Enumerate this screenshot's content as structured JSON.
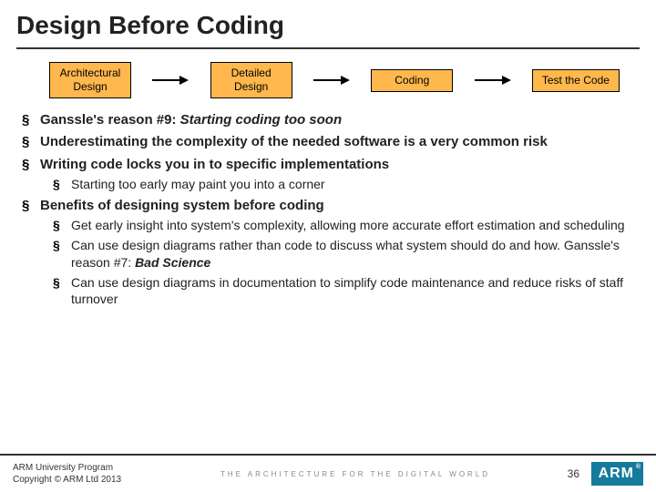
{
  "title": "Design Before Coding",
  "flow": {
    "boxes": [
      "Architectural\nDesign",
      "Detailed\nDesign",
      "Coding",
      "Test the Code"
    ]
  },
  "bullets": {
    "b1_pre": "Ganssle's reason #9: ",
    "b1_ital": "Starting coding too soon",
    "b2": "Underestimating the complexity of the needed software is a very common risk",
    "b3": "Writing code locks you in to specific implementations",
    "b3_sub1": "Starting too early may paint you into a corner",
    "b4": "Benefits of designing system before coding",
    "b4_sub1": "Get early insight into system's complexity, allowing more accurate effort estimation and scheduling",
    "b4_sub2_pre": "Can use design diagrams rather than code to discuss what system should do and how. Ganssle's reason #7: ",
    "b4_sub2_ital": "Bad Science",
    "b4_sub3": "Can use design diagrams in documentation to simplify code maintenance and reduce risks of staff turnover"
  },
  "footer": {
    "line1": "ARM University Program",
    "line2": "Copyright © ARM Ltd 2013",
    "tagline": "THE ARCHITECTURE FOR THE DIGITAL WORLD",
    "page": "36",
    "logo": "ARM"
  }
}
